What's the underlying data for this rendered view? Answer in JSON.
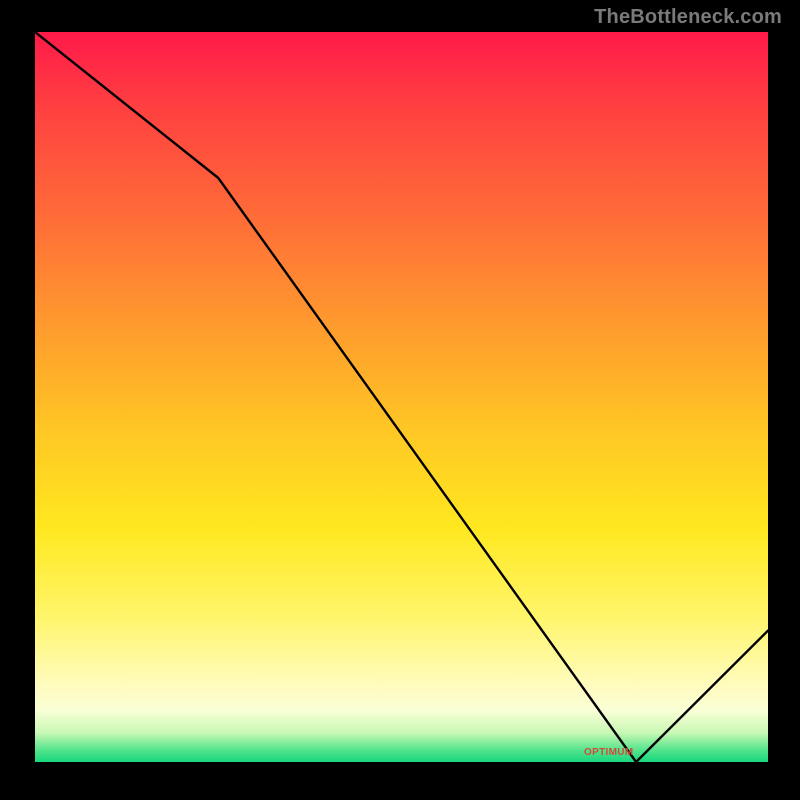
{
  "watermark": "TheBottleneck.com",
  "optimum_label": "OPTIMUM",
  "chart_data": {
    "type": "line",
    "title": "",
    "xlabel": "",
    "ylabel": "",
    "xlim": [
      0,
      100
    ],
    "ylim": [
      0,
      100
    ],
    "x": [
      0,
      25,
      82,
      100
    ],
    "values": [
      100,
      80,
      0,
      18
    ],
    "optimum_x": 82,
    "gradient_stops": [
      {
        "pos": 0.0,
        "color": "#ff1a4a"
      },
      {
        "pos": 0.4,
        "color": "#ff9a2e"
      },
      {
        "pos": 0.68,
        "color": "#ffe81f"
      },
      {
        "pos": 0.93,
        "color": "#f9ffd6"
      },
      {
        "pos": 1.0,
        "color": "#17d87f"
      }
    ]
  }
}
